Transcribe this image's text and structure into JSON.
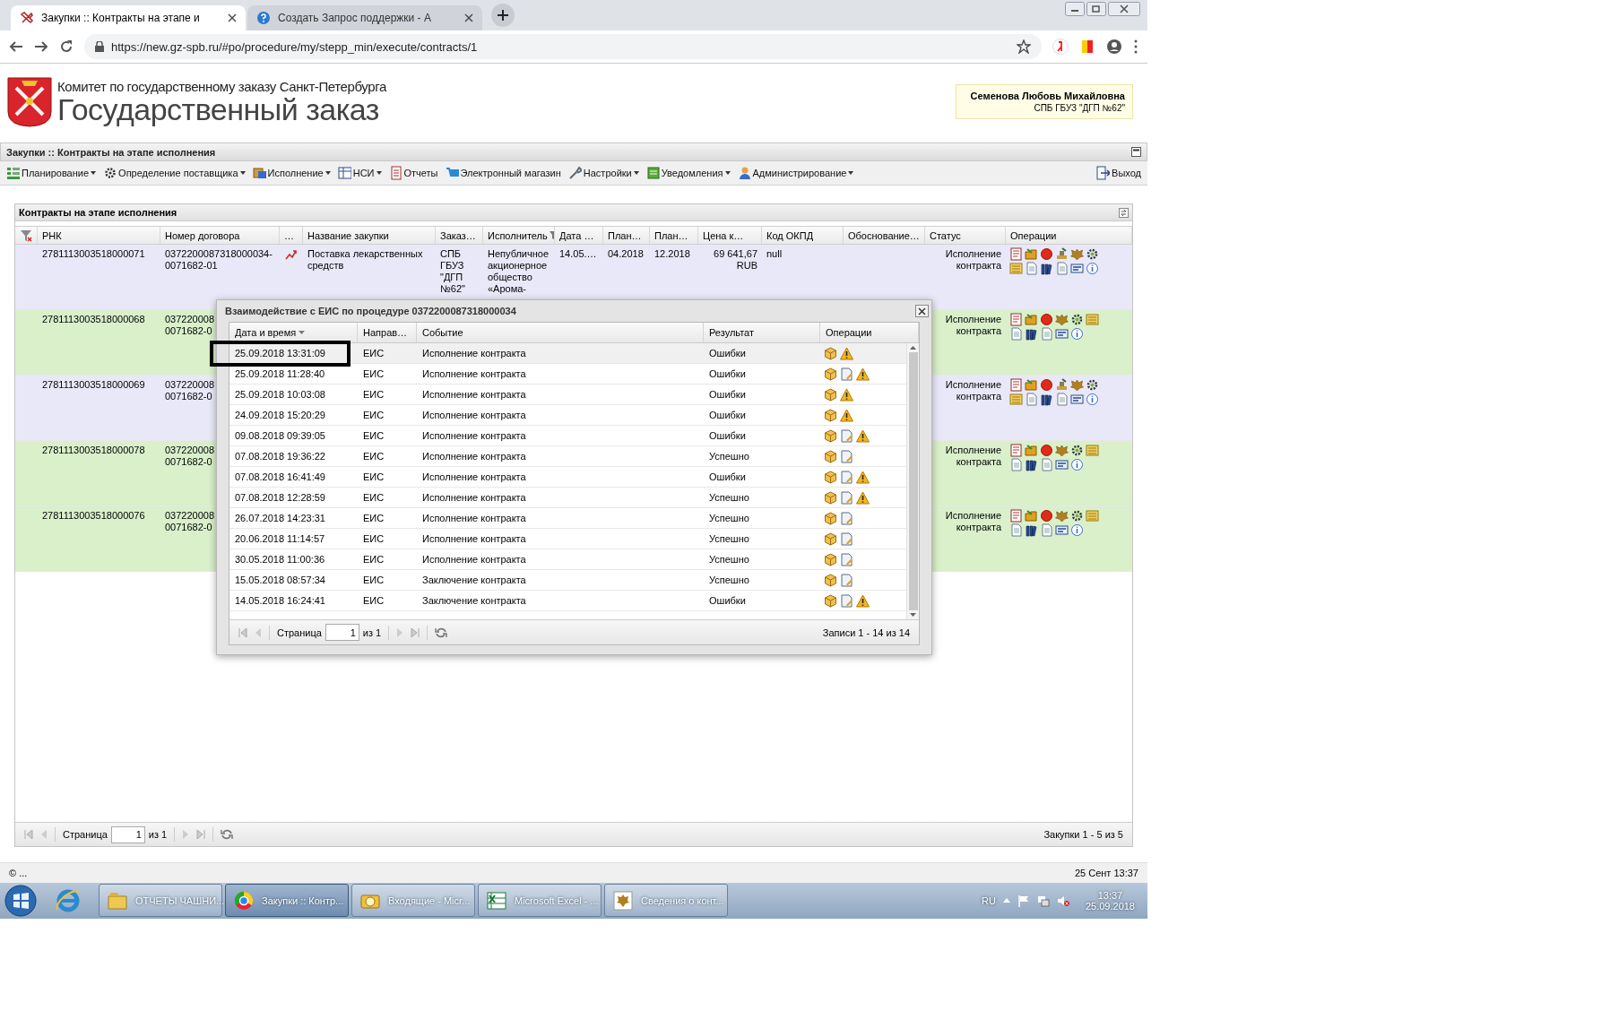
{
  "browser": {
    "tabs": [
      {
        "title": "Закупки :: Контракты на этапе и",
        "selected": true
      },
      {
        "title": "Создать Запрос поддержки - А",
        "selected": false
      }
    ],
    "url": "https://new.gz-spb.ru/#po/procedure/my/stepp_min/execute/contracts/1"
  },
  "header": {
    "org": "Комитет по государственному заказу Санкт-Петербурга",
    "title": "Государственный заказ",
    "user": {
      "name": "Семенова Любовь Михайловна",
      "org": "СПБ ГБУЗ \"ДГП №62\""
    }
  },
  "panel_title": "Закупки :: Контракты на этапе исполнения",
  "menu": [
    {
      "label": "Планирование",
      "dropdown": true
    },
    {
      "label": "Определение поставщика",
      "dropdown": true
    },
    {
      "label": "Исполнение",
      "dropdown": true
    },
    {
      "label": "НСИ",
      "dropdown": true
    },
    {
      "label": "Отчеты",
      "dropdown": false
    },
    {
      "label": "Электронный магазин",
      "dropdown": false
    },
    {
      "label": "Настройки",
      "dropdown": true
    },
    {
      "label": "Уведомления",
      "dropdown": true
    },
    {
      "label": "Администрирование",
      "dropdown": true
    }
  ],
  "logout": "Выход",
  "grid": {
    "title": "Контракты на этапе исполнения",
    "columns": [
      "РНК",
      "Номер договора",
      "…",
      "Название закупки",
      "Заказ…",
      "Исполнитель",
      "Дата …",
      "План…",
      "План…",
      "Цена к…",
      "Код ОКПД",
      "Обоснование…",
      "Статус",
      "Операции"
    ],
    "rows": [
      {
        "color": "#e8e8f8",
        "rnk": "2781113003518000071",
        "contract": "0372200087318000034-0071682-01",
        "link_icon": true,
        "name": "Поставка лекарственных средств",
        "customer": "СПБ ГБУЗ \"ДГП №62\"",
        "supplier": "Непубличное акционерное общество «Арома-",
        "date": "14.05.…",
        "plan_1": "04.2018",
        "plan_2": "12.2018",
        "price": "69 641,67 RUB",
        "okpd": "null",
        "status": "Исполнение контракта",
        "operations": [
          {
            "kind": "report"
          },
          {
            "kind": "folder"
          },
          {
            "kind": "stop"
          },
          {
            "kind": "stamp"
          },
          {
            "kind": "emblem"
          },
          {
            "kind": "gear"
          },
          {
            "kind": "scroll"
          },
          {
            "kind": "page"
          },
          {
            "kind": "books"
          },
          {
            "kind": "page"
          },
          {
            "kind": "card"
          },
          {
            "kind": "info"
          }
        ]
      },
      {
        "color": "#d9f0cb",
        "rnk": "2781113003518000068",
        "contract": "037220008\n0071682-0",
        "status": "Исполнение контракта",
        "operations": [
          {
            "kind": "report"
          },
          {
            "kind": "folder"
          },
          {
            "kind": "stop"
          },
          {
            "kind": "emblem"
          },
          {
            "kind": "gear"
          },
          {
            "kind": "scroll"
          },
          {
            "kind": "page"
          },
          {
            "kind": "books"
          },
          {
            "kind": "page"
          },
          {
            "kind": "card"
          },
          {
            "kind": "info"
          }
        ]
      },
      {
        "color": "#e8e8f8",
        "rnk": "2781113003518000069",
        "contract": "037220008\n0071682-0",
        "status": "Исполнение контракта",
        "operations": [
          {
            "kind": "report"
          },
          {
            "kind": "folder"
          },
          {
            "kind": "stop"
          },
          {
            "kind": "stamp"
          },
          {
            "kind": "emblem"
          },
          {
            "kind": "gear"
          },
          {
            "kind": "scroll"
          },
          {
            "kind": "page"
          },
          {
            "kind": "books"
          },
          {
            "kind": "page"
          },
          {
            "kind": "card"
          },
          {
            "kind": "info"
          }
        ]
      },
      {
        "color": "#d9f0cb",
        "rnk": "2781113003518000078",
        "contract": "037220008\n0071682-0",
        "status": "Исполнение контракта",
        "operations": [
          {
            "kind": "report"
          },
          {
            "kind": "folder"
          },
          {
            "kind": "stop"
          },
          {
            "kind": "emblem"
          },
          {
            "kind": "gear"
          },
          {
            "kind": "scroll"
          },
          {
            "kind": "page"
          },
          {
            "kind": "books"
          },
          {
            "kind": "page"
          },
          {
            "kind": "card"
          },
          {
            "kind": "info"
          }
        ]
      },
      {
        "color": "#d9f0cb",
        "rnk": "2781113003518000076",
        "contract": "037220008\n0071682-0",
        "status": "Исполнение контракта",
        "operations": [
          {
            "kind": "report"
          },
          {
            "kind": "folder"
          },
          {
            "kind": "stop"
          },
          {
            "kind": "emblem"
          },
          {
            "kind": "gear"
          },
          {
            "kind": "scroll"
          },
          {
            "kind": "page"
          },
          {
            "kind": "books"
          },
          {
            "kind": "page"
          },
          {
            "kind": "card"
          },
          {
            "kind": "info"
          }
        ]
      }
    ],
    "pager": {
      "page_label": "Страница",
      "page": "1",
      "of": "из 1",
      "summary": "Закупки 1 - 5 из 5"
    }
  },
  "dialog": {
    "title": "Взаимодействие с ЕИС по процедуре 0372200087318000034",
    "columns": [
      "Дата и время",
      "Направ…",
      "Событие",
      "Результат",
      "Операции"
    ],
    "rows": [
      {
        "datetime": "25.09.2018 13:31:09",
        "direction": "ЕИС",
        "event": "Исполнение контракта",
        "result": "Ошибки",
        "highlighted": true,
        "operations": [
          {
            "kind": "package"
          },
          {
            "kind": "warning"
          }
        ]
      },
      {
        "datetime": "25.09.2018 11:28:40",
        "direction": "ЕИС",
        "event": "Исполнение контракта",
        "result": "Ошибки",
        "highlighted": false,
        "operations": [
          {
            "kind": "package"
          },
          {
            "kind": "document"
          },
          {
            "kind": "warning"
          }
        ]
      },
      {
        "datetime": "25.09.2018 10:03:08",
        "direction": "ЕИС",
        "event": "Исполнение контракта",
        "result": "Ошибки",
        "highlighted": false,
        "operations": [
          {
            "kind": "package"
          },
          {
            "kind": "warning"
          }
        ]
      },
      {
        "datetime": "24.09.2018 15:20:29",
        "direction": "ЕИС",
        "event": "Исполнение контракта",
        "result": "Ошибки",
        "highlighted": false,
        "operations": [
          {
            "kind": "package"
          },
          {
            "kind": "warning"
          }
        ]
      },
      {
        "datetime": "09.08.2018 09:39:05",
        "direction": "ЕИС",
        "event": "Исполнение контракта",
        "result": "Ошибки",
        "highlighted": false,
        "operations": [
          {
            "kind": "package"
          },
          {
            "kind": "document"
          },
          {
            "kind": "warning"
          }
        ]
      },
      {
        "datetime": "07.08.2018 19:36:22",
        "direction": "ЕИС",
        "event": "Исполнение контракта",
        "result": "Успешно",
        "highlighted": false,
        "operations": [
          {
            "kind": "package"
          },
          {
            "kind": "document"
          }
        ]
      },
      {
        "datetime": "07.08.2018 16:41:49",
        "direction": "ЕИС",
        "event": "Исполнение контракта",
        "result": "Ошибки",
        "highlighted": false,
        "operations": [
          {
            "kind": "package"
          },
          {
            "kind": "document"
          },
          {
            "kind": "warning"
          }
        ]
      },
      {
        "datetime": "07.08.2018 12:28:59",
        "direction": "ЕИС",
        "event": "Исполнение контракта",
        "result": "Успешно",
        "highlighted": false,
        "operations": [
          {
            "kind": "package"
          },
          {
            "kind": "document"
          },
          {
            "kind": "warning"
          }
        ]
      },
      {
        "datetime": "26.07.2018 14:23:31",
        "direction": "ЕИС",
        "event": "Исполнение контракта",
        "result": "Успешно",
        "highlighted": false,
        "operations": [
          {
            "kind": "package"
          },
          {
            "kind": "document"
          }
        ]
      },
      {
        "datetime": "20.06.2018 11:14:57",
        "direction": "ЕИС",
        "event": "Исполнение контракта",
        "result": "Успешно",
        "highlighted": false,
        "operations": [
          {
            "kind": "package"
          },
          {
            "kind": "document"
          }
        ]
      },
      {
        "datetime": "30.05.2018 11:00:36",
        "direction": "ЕИС",
        "event": "Исполнение контракта",
        "result": "Успешно",
        "highlighted": false,
        "operations": [
          {
            "kind": "package"
          },
          {
            "kind": "document"
          }
        ]
      },
      {
        "datetime": "15.05.2018 08:57:34",
        "direction": "ЕИС",
        "event": "Заключение контракта",
        "result": "Успешно",
        "highlighted": false,
        "operations": [
          {
            "kind": "package"
          },
          {
            "kind": "document"
          }
        ]
      },
      {
        "datetime": "14.05.2018 16:24:41",
        "direction": "ЕИС",
        "event": "Заключение контракта",
        "result": "Ошибки",
        "highlighted": false,
        "operations": [
          {
            "kind": "package"
          },
          {
            "kind": "document"
          },
          {
            "kind": "warning"
          }
        ]
      }
    ],
    "pager": {
      "page_label": "Страница",
      "page": "1",
      "of": "из 1",
      "summary": "Записи 1 - 14 из 14"
    }
  },
  "status_bar": {
    "left": "© ...",
    "right": "25 Сент 13:37"
  },
  "taskbar": {
    "items": [
      {
        "label": "ОТЧЕТЫ ЧАШНИ...",
        "selected": false
      },
      {
        "label": "Закупки :: Контр...",
        "selected": true
      },
      {
        "label": "Входящие - Micr...",
        "selected": false
      },
      {
        "label": "Microsoft Excel - ...",
        "selected": false
      },
      {
        "label": "Сведения о конт...",
        "selected": false
      }
    ],
    "language": "RU",
    "time": "13:37",
    "date": "25.09.2018"
  }
}
